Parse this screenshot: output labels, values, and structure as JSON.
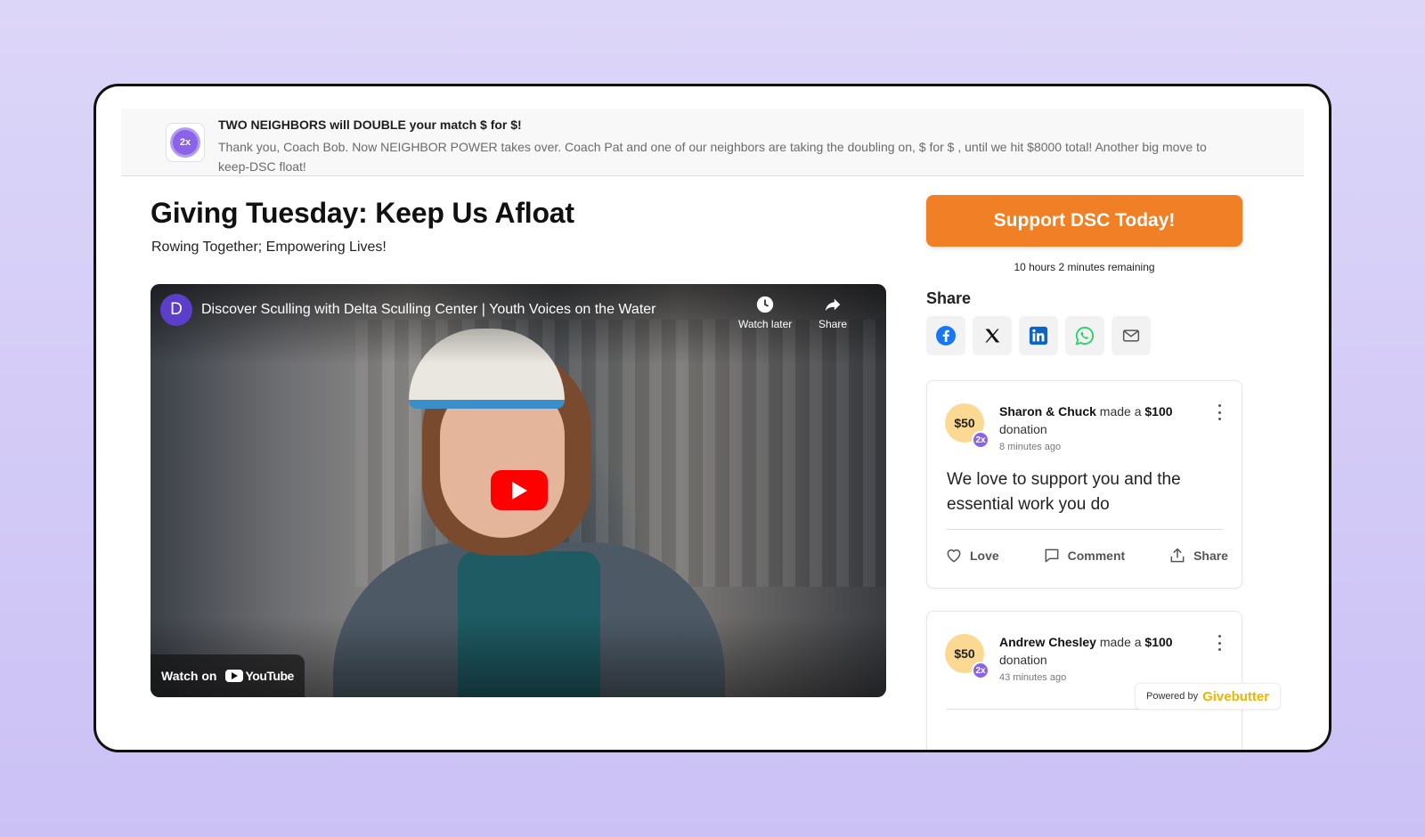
{
  "banner": {
    "badge": "2x",
    "title": "TWO NEIGHBORS will DOUBLE your match $ for $!",
    "text": "Thank you, Coach Bob. Now NEIGHBOR POWER takes over. Coach Pat and one of our neighbors are taking the doubling on, $ for $ , until we hit $8000 total! Another big move to keep-DSC float!"
  },
  "page": {
    "title": "Giving Tuesday: Keep Us Afloat",
    "subtitle": "Rowing Together; Empowering Lives!"
  },
  "video": {
    "channel_initial": "D",
    "title": "Discover Sculling with Delta Sculling Center | Youth Voices on the Water",
    "watch_later": "Watch later",
    "share": "Share",
    "watch_on": "Watch on",
    "youtube": "YouTube"
  },
  "sidebar": {
    "support_button": "Support DSC Today!",
    "remaining": "10 hours 2 minutes remaining",
    "share_heading": "Share",
    "share_icons": [
      "facebook-icon",
      "x-icon",
      "linkedin-icon",
      "whatsapp-icon",
      "email-icon"
    ]
  },
  "donations": [
    {
      "amount": "$50",
      "multiplier": "2x",
      "donor": "Sharon & Chuck",
      "made_a": "made a",
      "total": "$100",
      "donation_word": "donation",
      "time": "8 minutes ago",
      "message": "We love to support you and the essential work you do",
      "actions": {
        "love": "Love",
        "comment": "Comment",
        "share": "Share"
      }
    },
    {
      "amount": "$50",
      "multiplier": "2x",
      "donor": "Andrew Chesley",
      "made_a": "made a",
      "total": "$100",
      "donation_word": "donation",
      "time": "43 minutes ago"
    }
  ],
  "footer": {
    "powered_by": "Powered by",
    "brand": "Givebutter"
  },
  "colors": {
    "accent_orange": "#f07f26",
    "badge_purple": "#8a63e8",
    "amount_yellow": "#fcd992",
    "brand_yellow": "#f0b400"
  }
}
